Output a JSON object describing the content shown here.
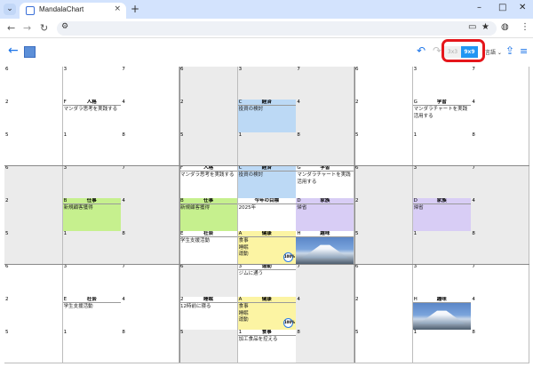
{
  "browser": {
    "tab_title": "MandalaChart",
    "new_tab": "+",
    "close": "×",
    "controls": {
      "minimize": "–",
      "maximize": "□",
      "close": "✕"
    }
  },
  "toolbar": {
    "toggle_3x3": "3x3",
    "toggle_9x9": "9x9",
    "language": "言語 ⌄"
  },
  "chart": {
    "themes": {
      "F": "人格",
      "C": "経済",
      "G": "学習",
      "B": "仕事",
      "D": "家族",
      "E": "社会",
      "A": "健康",
      "H": "趣味"
    },
    "goal_title": "今年の目標",
    "goal_text": "2025年",
    "cells": {
      "F_content": "マンダラ思考を実践する",
      "C_content": "投資の検討",
      "G_content": "マンダラチャートを実践活用する",
      "B_content": "新規顧客獲得",
      "D_content": "帰省",
      "E_content": "学生支援活動",
      "A_content": "食事\n睡眠\n運動",
      "A_badge": "100%",
      "A3_title": "運動",
      "A3_text": "ジムに通う",
      "A2_title": "睡眠",
      "A2_text": "12時前に寝る",
      "A1_title": "食事",
      "A1_text": "加工食品を控える"
    }
  }
}
